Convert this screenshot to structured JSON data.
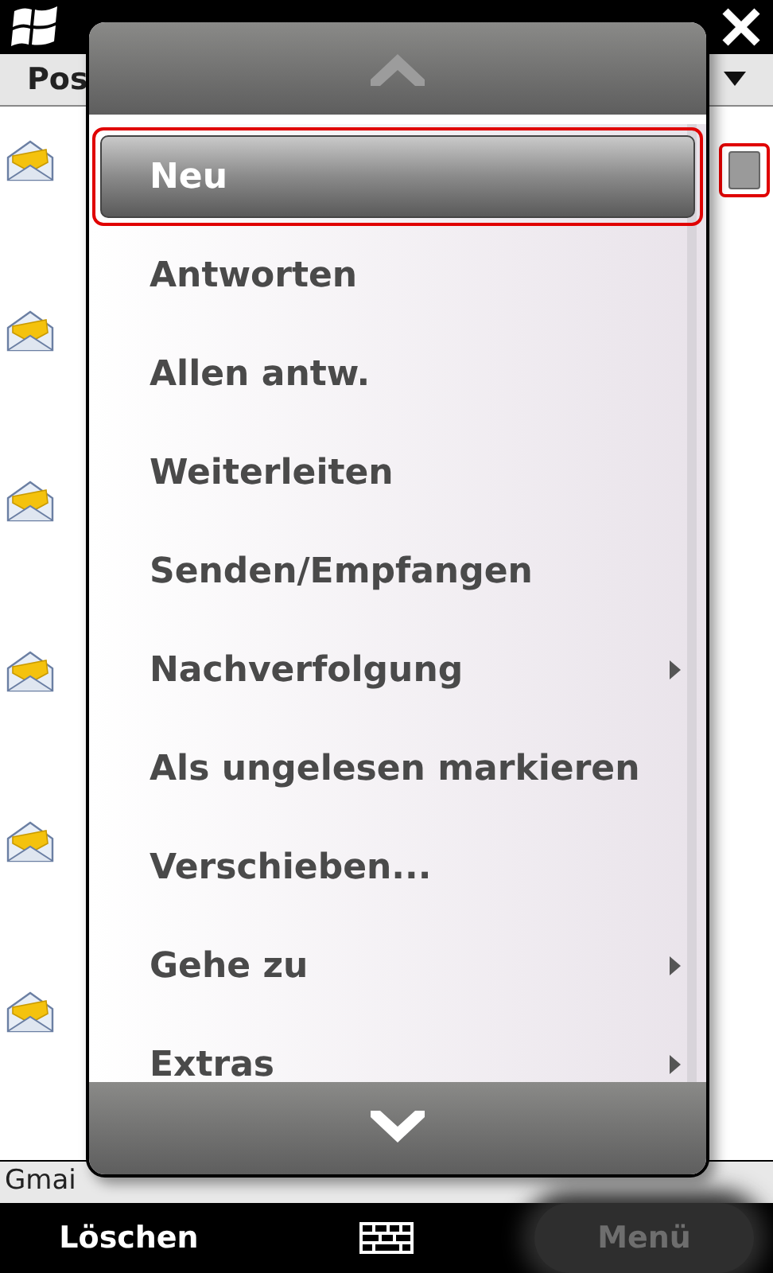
{
  "header": {
    "title": "Pos"
  },
  "messages": [
    {
      "read": true
    },
    {
      "read": true
    },
    {
      "read": true
    },
    {
      "read": true
    },
    {
      "read": true
    },
    {
      "read": true
    }
  ],
  "status_bar": {
    "text": "Gmai"
  },
  "menu": {
    "items": [
      {
        "label": "Neu",
        "selected": true,
        "has_submenu": false
      },
      {
        "label": "Antworten",
        "selected": false,
        "has_submenu": false
      },
      {
        "label": "Allen antw.",
        "selected": false,
        "has_submenu": false
      },
      {
        "label": "Weiterleiten",
        "selected": false,
        "has_submenu": false
      },
      {
        "label": "Senden/Empfangen",
        "selected": false,
        "has_submenu": false
      },
      {
        "label": "Nachverfolgung",
        "selected": false,
        "has_submenu": true
      },
      {
        "label": "Als ungelesen markieren",
        "selected": false,
        "has_submenu": false
      },
      {
        "label": "Verschieben...",
        "selected": false,
        "has_submenu": false
      },
      {
        "label": "Gehe zu",
        "selected": false,
        "has_submenu": true
      },
      {
        "label": "Extras",
        "selected": false,
        "has_submenu": true
      }
    ]
  },
  "softkeys": [
    {
      "label": "Löschen",
      "pressed": false
    },
    {
      "label": "Menü",
      "pressed": true
    }
  ]
}
